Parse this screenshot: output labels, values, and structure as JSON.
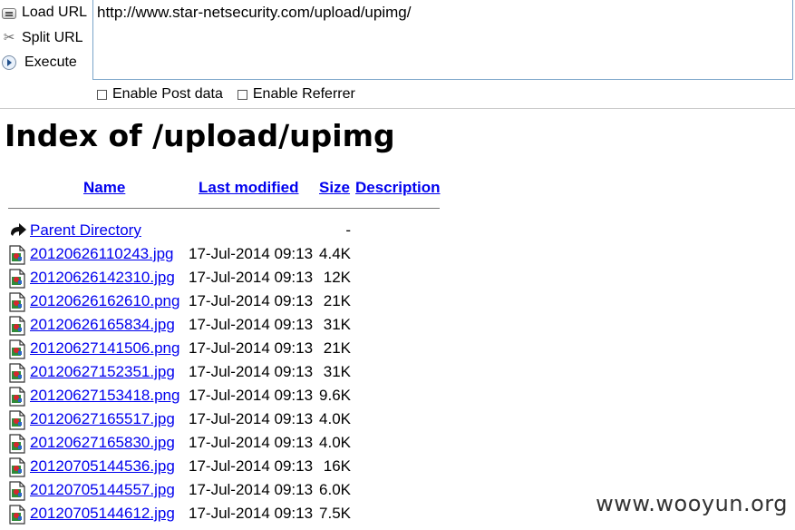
{
  "hackbar": {
    "load_label": "Load URL",
    "split_label": "Split URL",
    "execute_label": "Execute",
    "url_value": "http://www.star-netsecurity.com/upload/upimg/",
    "post_label": "Enable Post data",
    "referrer_label": "Enable Referrer"
  },
  "page": {
    "title": "Index of /upload/upimg",
    "columns": {
      "name": "Name",
      "modified": "Last modified",
      "size": "Size",
      "description": "Description"
    },
    "parent": {
      "label": "Parent Directory",
      "size": "-"
    },
    "files": [
      {
        "name": "20120626110243.jpg",
        "modified": "17-Jul-2014 09:13",
        "size": "4.4K"
      },
      {
        "name": "20120626142310.jpg",
        "modified": "17-Jul-2014 09:13",
        "size": "12K"
      },
      {
        "name": "20120626162610.png",
        "modified": "17-Jul-2014 09:13",
        "size": "21K"
      },
      {
        "name": "20120626165834.jpg",
        "modified": "17-Jul-2014 09:13",
        "size": "31K"
      },
      {
        "name": "20120627141506.png",
        "modified": "17-Jul-2014 09:13",
        "size": "21K"
      },
      {
        "name": "20120627152351.jpg",
        "modified": "17-Jul-2014 09:13",
        "size": "31K"
      },
      {
        "name": "20120627153418.png",
        "modified": "17-Jul-2014 09:13",
        "size": "9.6K"
      },
      {
        "name": "20120627165517.jpg",
        "modified": "17-Jul-2014 09:13",
        "size": "4.0K"
      },
      {
        "name": "20120627165830.jpg",
        "modified": "17-Jul-2014 09:13",
        "size": "4.0K"
      },
      {
        "name": "20120705144536.jpg",
        "modified": "17-Jul-2014 09:13",
        "size": "16K"
      },
      {
        "name": "20120705144557.jpg",
        "modified": "17-Jul-2014 09:13",
        "size": "6.0K"
      },
      {
        "name": "20120705144612.jpg",
        "modified": "17-Jul-2014 09:13",
        "size": "7.5K"
      }
    ]
  },
  "watermark": "www.wooyun.org"
}
